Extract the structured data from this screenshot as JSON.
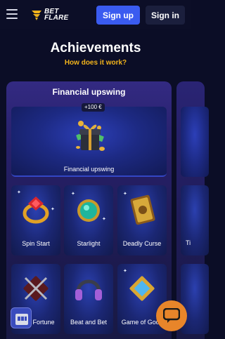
{
  "header": {
    "logo_line1": "BET",
    "logo_line2": "FLARE",
    "signup_label": "Sign up",
    "signin_label": "Sign in"
  },
  "page": {
    "title": "Achievements",
    "how_link": "How does it work?"
  },
  "panel": {
    "title": "Financial upswing",
    "featured": {
      "badge": "+100 €",
      "label": "Financial upswing"
    },
    "cards": [
      {
        "label": "Spin Start"
      },
      {
        "label": "Starlight"
      },
      {
        "label": "Deadly Curse"
      },
      {
        "label": "Fortune"
      },
      {
        "label": "Beat and Bet"
      },
      {
        "label": "Game of Gods"
      }
    ],
    "next_card_label": "Ti"
  },
  "colors": {
    "accent_blue": "#3a5bf0",
    "accent_gold": "#f1b31c",
    "chat_orange": "#e8852a"
  }
}
